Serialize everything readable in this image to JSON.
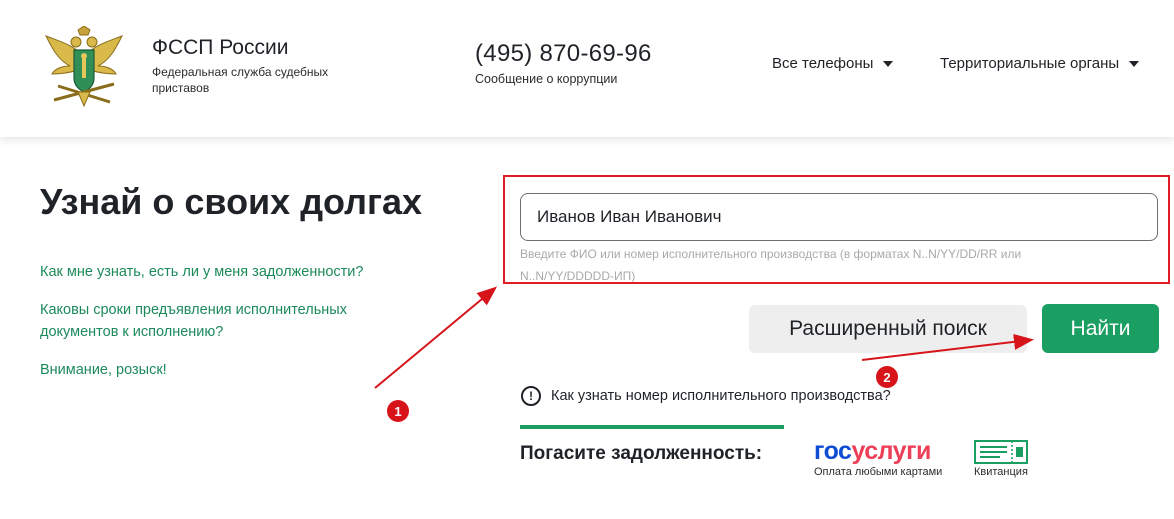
{
  "header": {
    "org_name": "ФССП России",
    "org_subtitle": "Федеральная служба судебных приставов",
    "phone": "(495) 870-69-96",
    "phone_subtitle": "Сообщение о коррупции",
    "nav": [
      {
        "label": "Все телефоны",
        "icon": "caret-down-icon"
      },
      {
        "label": "Территориальные органы",
        "icon": "caret-down-icon"
      }
    ]
  },
  "main": {
    "title": "Узнай о своих долгах",
    "links": [
      "Как мне узнать, есть ли у меня задолженности?",
      "Каковы сроки предъявления исполнительных документов к исполнению?",
      "Внимание, розыск!"
    ]
  },
  "search": {
    "value": "Иванов Иван Иванович",
    "hint": "Введите ФИО или номер исполнительного производства (в форматах N..N/YY/DD/RR или N..N/YY/DDDDD-ИП)",
    "advanced_label": "Расширенный поиск",
    "find_label": "Найти"
  },
  "help": {
    "icon": "info-circle-icon",
    "text": "Как узнать номер исполнительного производства?"
  },
  "payment": {
    "label": "Погасите задолженность:",
    "gosuslugi_part1": "гос",
    "gosuslugi_part2": "услуги",
    "gosuslugi_sub": "Оплата любыми картами",
    "receipt_sub": "Квитанция"
  },
  "annotations": {
    "badge1": "1",
    "badge2": "2",
    "color": "#d7141a"
  },
  "colors": {
    "accent": "#1a9e62",
    "link": "#1c8a5b",
    "gos_blue": "#0d4cd3",
    "gos_red": "#ee3f58"
  }
}
